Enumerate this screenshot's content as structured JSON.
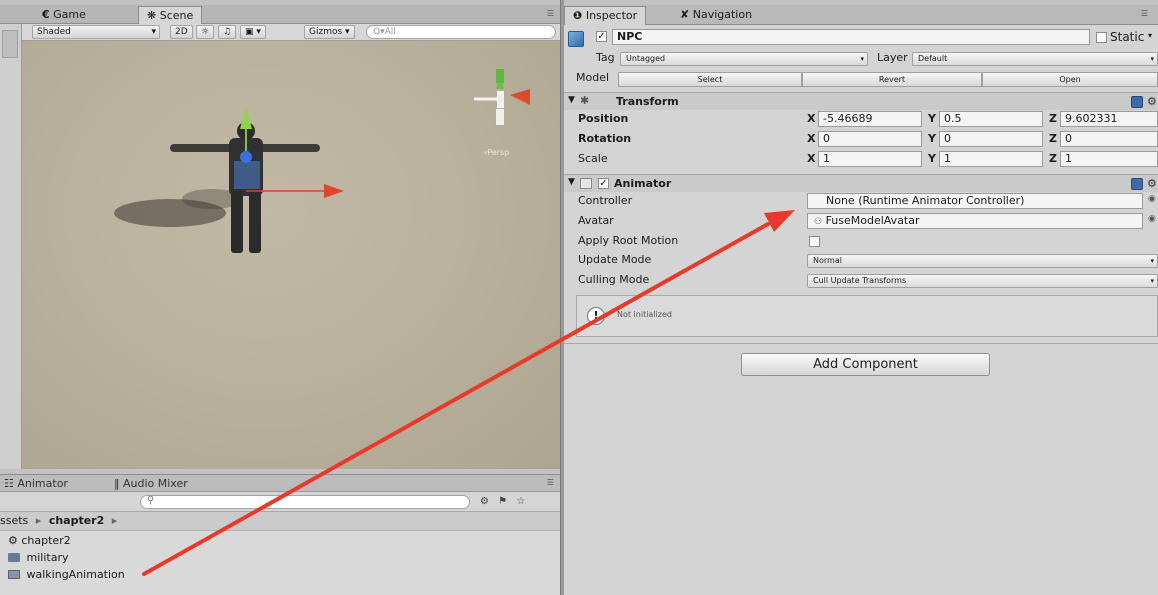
{
  "scene_tabs": {
    "game_label": "Game",
    "scene_label": "Scene"
  },
  "scene_toolbar": {
    "shading": "Shaded",
    "mode_2d": "2D",
    "gizmos": "Gizmos",
    "search_placeholder": "Q▾All"
  },
  "bottom_panel": {
    "tabs": [
      "Animator",
      "Audio Mixer"
    ],
    "breadcrumb_root": "ssets",
    "breadcrumb_sep": "▸",
    "breadcrumb_current": "chapter2",
    "assets": [
      {
        "name": "chapter2",
        "icon": "unity-scene-icon"
      },
      {
        "name": "military",
        "icon": "folder-icon"
      },
      {
        "name": "walkingAnimation",
        "icon": "animation-file-icon"
      }
    ]
  },
  "inspector": {
    "tabs": [
      "Inspector",
      "Navigation"
    ],
    "object_name": "NPC",
    "static_label": "Static",
    "tag_label": "Tag",
    "tag_value": "Untagged",
    "layer_label": "Layer",
    "layer_value": "Default",
    "model_label": "Model",
    "model_buttons": [
      "Select",
      "Revert",
      "Open"
    ],
    "transform": {
      "title": "Transform",
      "position_label": "Position",
      "rotation_label": "Rotation",
      "scale_label": "Scale",
      "axis_x": "X",
      "axis_y": "Y",
      "axis_z": "Z",
      "position": {
        "x": "-5.46689",
        "y": "0.5",
        "z": "9.602331"
      },
      "rotation": {
        "x": "0",
        "y": "0",
        "z": "0"
      },
      "scale": {
        "x": "1",
        "y": "1",
        "z": "1"
      }
    },
    "animator": {
      "title": "Animator",
      "controller_label": "Controller",
      "controller_value": "None (Runtime Animator Controller)",
      "avatar_label": "Avatar",
      "avatar_value": "FuseModelAvatar",
      "root_motion_label": "Apply Root Motion",
      "update_mode_label": "Update Mode",
      "update_mode_value": "Normal",
      "culling_mode_label": "Culling Mode",
      "culling_mode_value": "Cull Update Transforms",
      "status_text": "Not initialized"
    },
    "add_component_label": "Add Component"
  },
  "colors": {
    "annotation_arrow": "#e8392b",
    "component_icon": "#3f6aa8"
  }
}
